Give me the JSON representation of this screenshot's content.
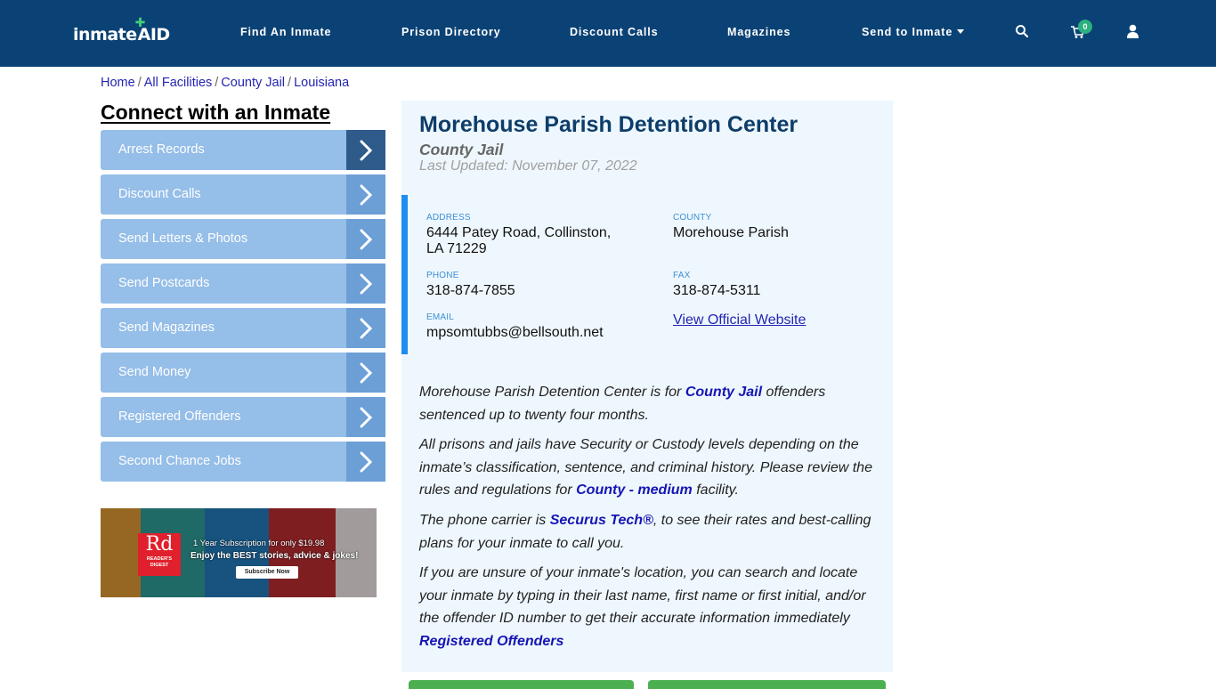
{
  "header": {
    "logo_text_left": "inmate",
    "logo_text_right": "AID",
    "nav": [
      {
        "label": "Find An Inmate"
      },
      {
        "label": "Prison Directory"
      },
      {
        "label": "Discount Calls"
      },
      {
        "label": "Magazines"
      },
      {
        "label": "Send to Inmate",
        "has_dropdown": true
      }
    ],
    "icons": [
      "search-icon",
      "cart-icon",
      "user-icon"
    ],
    "cart_count": "0",
    "background": "#0b4275"
  },
  "breadcrumb": [
    {
      "label": "Home"
    },
    {
      "label": "All Facilities"
    },
    {
      "label": "County Jail"
    },
    {
      "label": "Louisiana"
    }
  ],
  "breadcrumb_separator": "/",
  "sidebar": {
    "title": "Connect with an Inmate",
    "items": [
      {
        "label": "Arrest Records",
        "active": true
      },
      {
        "label": "Discount Calls"
      },
      {
        "label": "Send Letters & Photos"
      },
      {
        "label": "Send Postcards"
      },
      {
        "label": "Send Magazines"
      },
      {
        "label": "Send Money"
      },
      {
        "label": "Registered Offenders"
      },
      {
        "label": "Second Chance Jobs"
      }
    ],
    "ad": {
      "brand_big": "Rd",
      "brand_small_1": "READER'S",
      "brand_small_2": "DIGEST",
      "line1": "1 Year Subscription for only $19.98",
      "line2": "Enjoy the BEST stories, advice & jokes!",
      "button": "Subscribe Now"
    }
  },
  "facility": {
    "name": "Morehouse Parish Detention Center",
    "type": "County Jail",
    "last_updated": "Last Updated: November 07, 2022",
    "address_label": "ADDRESS",
    "address_line1": "6444 Patey Road, Collinston,",
    "address_line2": "LA 71229",
    "county_label": "COUNTY",
    "county": "Morehouse Parish",
    "phone_label": "PHONE",
    "phone": "318-874-7855",
    "fax_label": "FAX",
    "fax": "318-874-5311",
    "email_label": "EMAIL",
    "email": "mpsomtubbs@bellsouth.net",
    "website_link": "View Official Website"
  },
  "description": {
    "p1_a": "Morehouse Parish Detention Center is for ",
    "p1_link": "County Jail",
    "p1_b": " offenders sentenced up to twenty four months.",
    "p2_a": "All prisons and jails have Security or Custody levels depending on the inmate’s classification, sentence, and criminal history. Please review the rules and regulations for ",
    "p2_link": "County - medium",
    "p2_b": " facility.",
    "p3_a": "The phone carrier is ",
    "p3_link": "Securus Tech®",
    "p3_b": ", to see their rates and best-calling plans for your inmate to call you.",
    "p4_a": "If you are unsure of your inmate's location, you can search and locate your inmate by typing in their last name, first name or first initial, and/or the offender ID number to get their accurate information immediately ",
    "p4_link": "Registered Offenders"
  },
  "colors": {
    "accent_blue": "#1b8ef0",
    "link": "#2424b4",
    "button_green": "#4caf50"
  }
}
